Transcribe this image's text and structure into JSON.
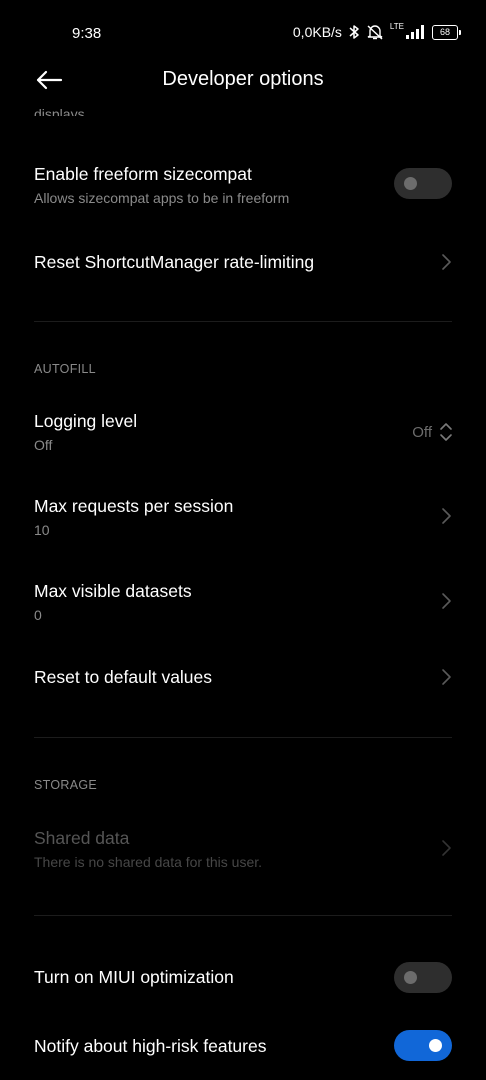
{
  "status_bar": {
    "time": "9:38",
    "network_speed": "0,0KB/s",
    "network_type": "LTE",
    "battery": "68",
    "icons": [
      "bluetooth-icon",
      "alarm-off-icon",
      "signal-icon",
      "battery-icon"
    ]
  },
  "app_bar": {
    "title": "Developer options",
    "back_icon": "arrow-left-icon"
  },
  "cut_text": "displays",
  "items": {
    "freeform": {
      "title": "Enable freeform sizecompat",
      "subtitle": "Allows sizecompat apps to be in freeform",
      "enabled": false
    },
    "reset_shortcut": {
      "title": "Reset ShortcutManager rate-limiting"
    },
    "logging_level": {
      "title": "Logging level",
      "subtitle": "Off",
      "value": "Off"
    },
    "max_requests": {
      "title": "Max requests per session",
      "subtitle": "10"
    },
    "max_datasets": {
      "title": "Max visible datasets",
      "subtitle": "0"
    },
    "reset_defaults": {
      "title": "Reset to default values"
    },
    "shared_data": {
      "title": "Shared data",
      "subtitle": "There is no shared data for this user."
    },
    "miui_opt": {
      "title": "Turn on MIUI optimization",
      "enabled": false
    },
    "notify_risk": {
      "title": "Notify about high-risk features",
      "enabled": true
    }
  },
  "sections": {
    "autofill": "AUTOFILL",
    "storage": "STORAGE"
  },
  "colors": {
    "background": "#000000",
    "accent": "#1167d8",
    "toggle_off": "#2e2e2e",
    "secondary_text": "#8a8a8a"
  }
}
